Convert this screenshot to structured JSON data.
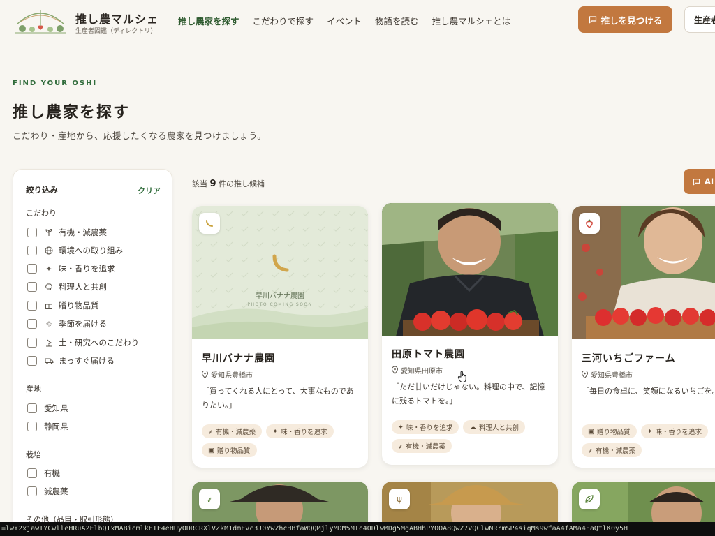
{
  "header": {
    "brand_title": "推し農マルシェ",
    "brand_subtitle": "生産者図鑑（ディレクトリ）",
    "nav": [
      "推し農家を探す",
      "こだわりで探す",
      "イベント",
      "物語を読む",
      "推し農マルシェとは"
    ],
    "primary_button": "推しを見つける",
    "secondary_button": "生産者"
  },
  "hero": {
    "eyebrow": "FIND YOUR OSHI",
    "title": "推し農家を探す",
    "description": "こだわり・産地から、応援したくなる農家を見つけましょう。"
  },
  "sidebar": {
    "title": "絞り込み",
    "clear": "クリア",
    "group_kodawari": "こだわり",
    "kodawari": [
      {
        "label": "有機・減農薬",
        "icon": "sprout-icon"
      },
      {
        "label": "環境への取り組み",
        "icon": "globe-icon"
      },
      {
        "label": "味・香りを追求",
        "icon": "sparkle-icon"
      },
      {
        "label": "料理人と共創",
        "icon": "chef-hat-icon"
      },
      {
        "label": "贈り物品質",
        "icon": "gift-icon"
      },
      {
        "label": "季節を届ける",
        "icon": "sun-icon"
      },
      {
        "label": "土・研究へのこだわり",
        "icon": "microscope-icon"
      },
      {
        "label": "まっすぐ届ける",
        "icon": "truck-icon"
      }
    ],
    "group_sanchi": "産地",
    "sanchi": [
      "愛知県",
      "静岡県"
    ],
    "group_saibai": "栽培",
    "saibai": [
      "有機",
      "減農薬"
    ],
    "group_other": "その他（品目・取引形態）"
  },
  "results": {
    "prefix": "該当",
    "count": "9",
    "suffix": "件の推し候補",
    "ai_button": "AI"
  },
  "cards": [
    {
      "name": "早川バナナ農園",
      "location": "愛知県豊橋市",
      "quote": "「買ってくれる人にとって、大事なものでありたい。」",
      "placeholder_title": "早川バナナ農園",
      "placeholder_sub": "PHOTO COMING SOON",
      "tags": [
        "有機・減農薬",
        "味・香りを追求",
        "贈り物品質"
      ]
    },
    {
      "name": "田原トマト農園",
      "location": "愛知県田原市",
      "quote": "「ただ甘いだけじゃない。料理の中で、記憶に残るトマトを。」",
      "tags": [
        "味・香りを追求",
        "料理人と共創",
        "有機・減農薬"
      ]
    },
    {
      "name": "三河いちごファーム",
      "location": "愛知県豊橋市",
      "quote": "「毎日の食卓に、笑顔になるいちごを。」",
      "tags": [
        "贈り物品質",
        "味・香りを追求",
        "有機・減農薬"
      ]
    }
  ],
  "bottom_bar": "=lwY2xjawTYCwlleHRuA2FlbQIxMABicmlkETF4eHUyODRCRXlVZkM1dmFvc3J0YwZhcHBfaWQQMjlyMDM5MTc4ODlwMDg5MgABHhPYOOA8QwZ7VQClwNRrmSP4siqMs9wfaA4fAMa4FaQtlK0y5H",
  "colors": {
    "accent": "#c2783f",
    "green": "#2f6b3a",
    "tag_bg": "#f6ebdd"
  }
}
